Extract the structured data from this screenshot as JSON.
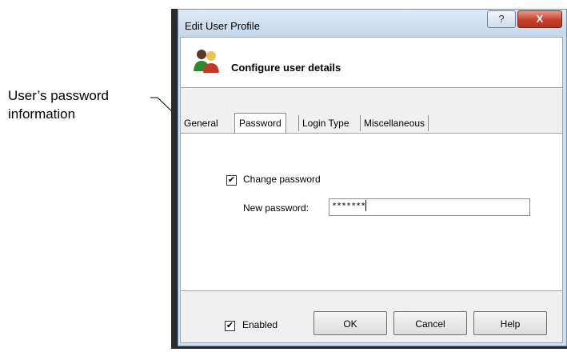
{
  "callout": {
    "line1": "User’s password",
    "line2": "information"
  },
  "window": {
    "title": "Edit User Profile",
    "help_glyph": "?",
    "close_glyph": "X"
  },
  "header": {
    "title": "Configure user details",
    "icon": "users-icon"
  },
  "tabs": [
    {
      "label": "General"
    },
    {
      "label": "Password",
      "selected": true
    },
    {
      "label": "Login Type"
    },
    {
      "label": "Miscellaneous"
    }
  ],
  "password_tab": {
    "change_password_label": "Change password",
    "change_password_checked": true,
    "new_password_label": "New password:",
    "new_password_value": "*******"
  },
  "footer": {
    "enabled_label": "Enabled",
    "enabled_checked": true,
    "ok_label": "OK",
    "cancel_label": "Cancel",
    "help_label": "Help"
  },
  "colors": {
    "close_button": "#c53f2c",
    "window_frame": "#cfe0f2"
  }
}
